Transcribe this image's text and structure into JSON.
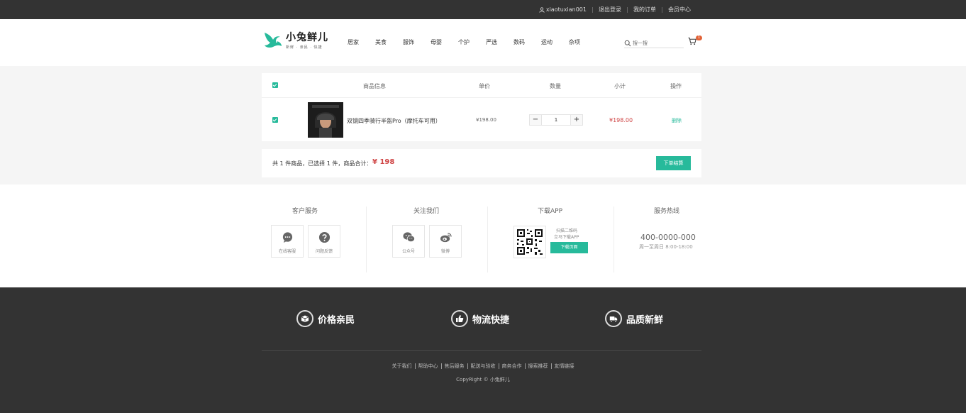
{
  "topbar": {
    "username": "xiaotuxian001",
    "logout": "退出登录",
    "orders": "我的订单",
    "member": "会员中心"
  },
  "header": {
    "logo_name": "小兔鲜儿",
    "logo_slogan": "新鲜 · 亲民 · 快捷",
    "nav": [
      "居家",
      "美食",
      "服饰",
      "母婴",
      "个护",
      "严选",
      "数码",
      "运动",
      "杂项"
    ],
    "search_placeholder": "搜一搜",
    "cart_count": "1"
  },
  "cart": {
    "headers": {
      "info": "商品信息",
      "price": "单价",
      "qty": "数量",
      "subtotal": "小计",
      "action": "操作"
    },
    "item": {
      "name": "双镜四季骑行半盔Pro（摩托车可用）",
      "price": "¥198.00",
      "qty": "1",
      "subtotal": "¥198.00",
      "delete": "删除",
      "minus": "−",
      "plus": "+"
    }
  },
  "summary": {
    "text": "共 1 件商品，已选择 1 件，商品合计：",
    "total": "¥ 198",
    "checkout": "下单结算"
  },
  "service": {
    "customer": {
      "title": "客户服务",
      "online": "在线客服",
      "feedback": "问题反馈"
    },
    "follow": {
      "title": "关注我们",
      "wechat": "公众号",
      "weibo": "微博"
    },
    "app": {
      "title": "下载APP",
      "scan": "扫描二维码",
      "download_text": "立马下载APP",
      "download_btn": "下载页面"
    },
    "hotline": {
      "title": "服务热线",
      "phone": "400-0000-000",
      "hours": "周一至周日 8:00-18:00"
    }
  },
  "footer": {
    "features": [
      "价格亲民",
      "物流快捷",
      "品质新鲜"
    ],
    "links": [
      "关于我们",
      "帮助中心",
      "售后服务",
      "配送与验收",
      "商务合作",
      "搜索推荐",
      "友情链接"
    ],
    "copyright": "CopyRight © 小兔鲜儿"
  },
  "colors": {
    "accent": "#27ba9b",
    "price": "#cf4444",
    "dark": "#333333"
  }
}
